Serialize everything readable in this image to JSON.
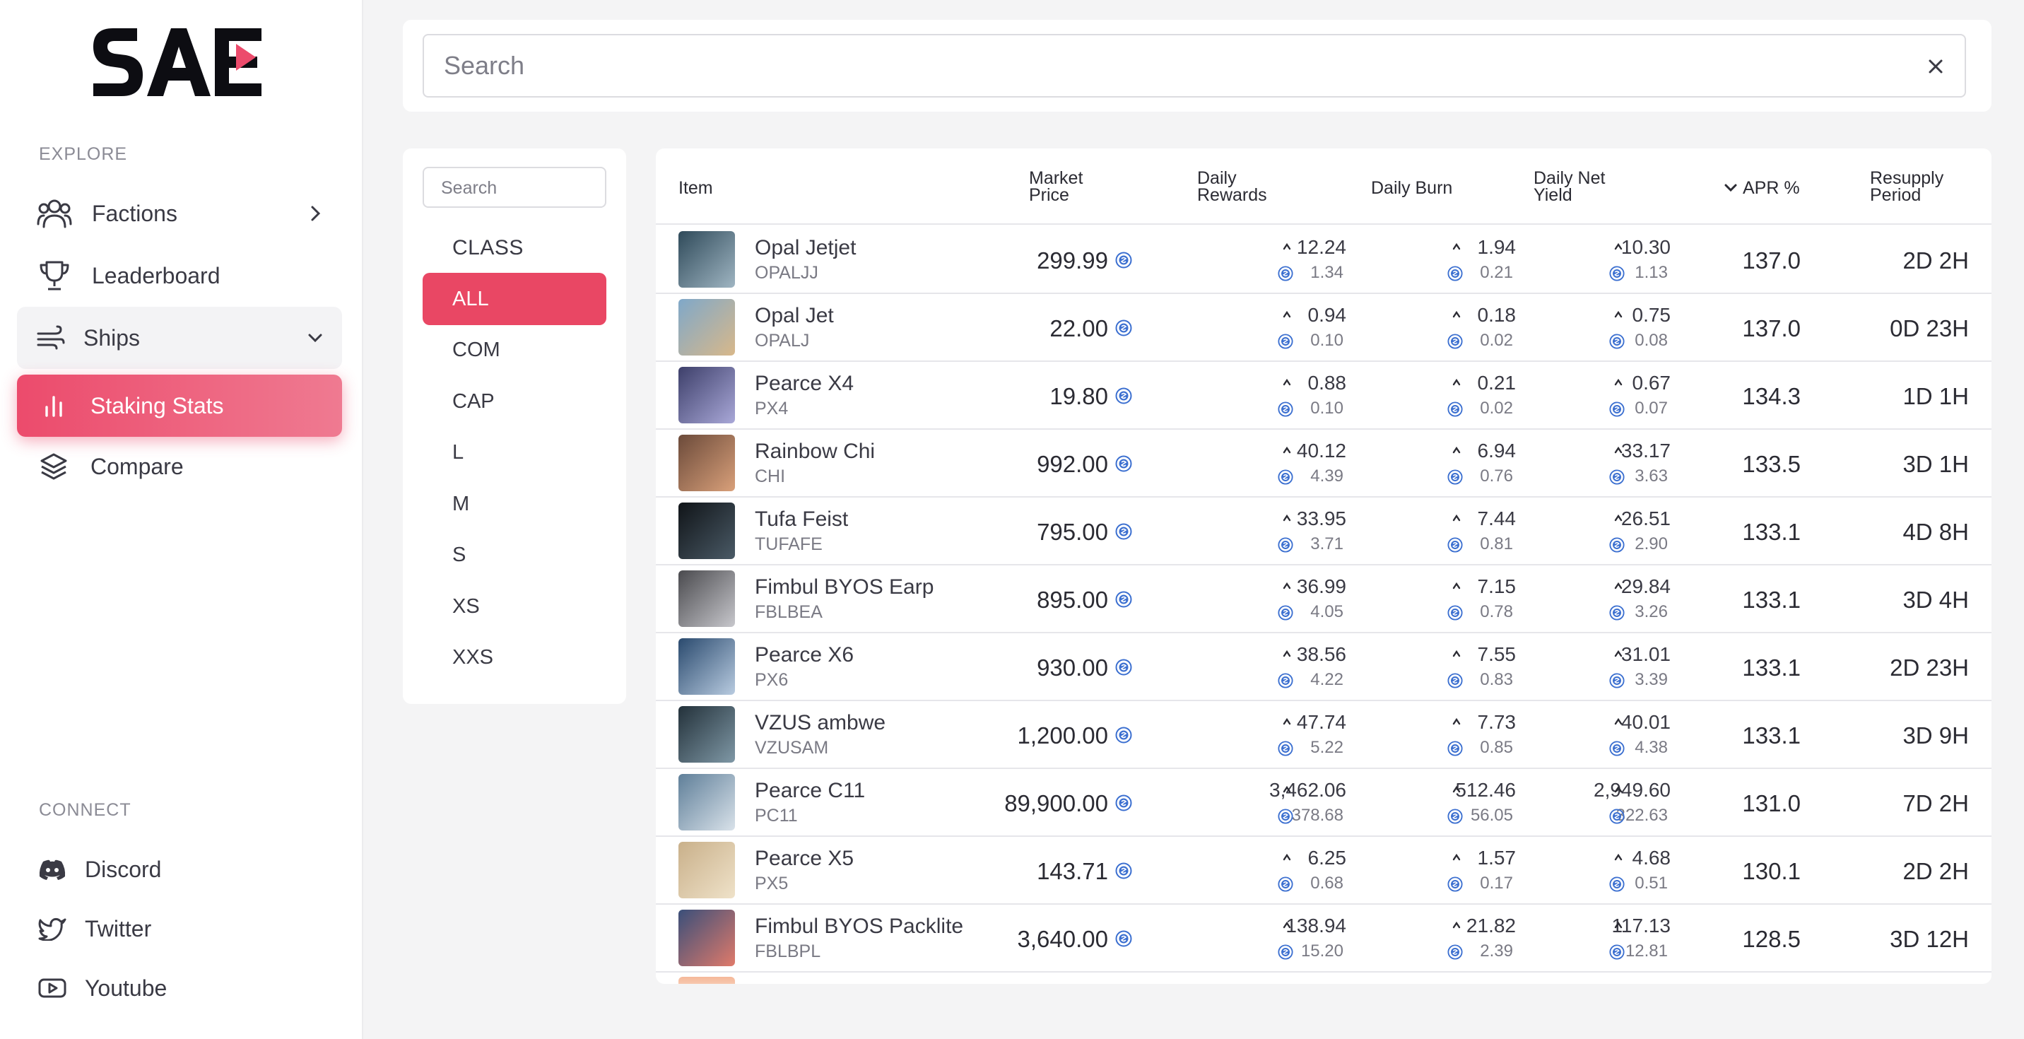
{
  "brand": {
    "logo_text": "SAE",
    "accent": "#e94764"
  },
  "sidebar": {
    "explore_label": "EXPLORE",
    "items": [
      {
        "label": "Factions",
        "icon": "users-icon",
        "chevron": "chevron-right-icon"
      },
      {
        "label": "Leaderboard",
        "icon": "trophy-icon"
      },
      {
        "label": "Ships",
        "icon": "wind-icon",
        "chevron": "chevron-down-icon"
      },
      {
        "label": "Staking Stats",
        "icon": "bar-chart-icon",
        "active": true
      },
      {
        "label": "Compare",
        "icon": "layers-icon"
      }
    ],
    "connect_label": "CONNECT",
    "connect": [
      {
        "label": "Discord",
        "icon": "discord-icon"
      },
      {
        "label": "Twitter",
        "icon": "twitter-icon"
      },
      {
        "label": "Youtube",
        "icon": "youtube-icon"
      }
    ]
  },
  "search": {
    "placeholder": "Search"
  },
  "filter": {
    "search_placeholder": "Search",
    "title": "CLASS",
    "classes": [
      "ALL",
      "COM",
      "CAP",
      "L",
      "M",
      "S",
      "XS",
      "XXS"
    ],
    "selected": "ALL"
  },
  "table": {
    "headers": {
      "item": "Item",
      "market_price": [
        "Market",
        "Price"
      ],
      "daily_rewards": [
        "Daily",
        "Rewards"
      ],
      "daily_burn": "Daily Burn",
      "daily_net_yield": [
        "Daily Net",
        "Yield"
      ],
      "apr": "APR %",
      "resupply": [
        "Resupply",
        "Period"
      ]
    },
    "sort": {
      "column": "apr",
      "direction": "desc"
    },
    "rows": [
      {
        "name": "Opal Jetjet",
        "code": "OPALJJ",
        "price": "299.99",
        "rewards": "12.24",
        "rewards_sub": "1.34",
        "burn": "1.94",
        "burn_sub": "0.21",
        "net": "10.30",
        "net_sub": "1.13",
        "apr": "137.0",
        "resupply": "2D 2H",
        "thumb": [
          "#2f4a5a",
          "#9fb5c2"
        ]
      },
      {
        "name": "Opal Jet",
        "code": "OPALJ",
        "price": "22.00",
        "rewards": "0.94",
        "rewards_sub": "0.10",
        "burn": "0.18",
        "burn_sub": "0.02",
        "net": "0.75",
        "net_sub": "0.08",
        "apr": "137.0",
        "resupply": "0D 23H",
        "thumb": [
          "#7fa8c9",
          "#d8b88a"
        ]
      },
      {
        "name": "Pearce X4",
        "code": "PX4",
        "price": "19.80",
        "rewards": "0.88",
        "rewards_sub": "0.10",
        "burn": "0.21",
        "burn_sub": "0.02",
        "net": "0.67",
        "net_sub": "0.07",
        "apr": "134.3",
        "resupply": "1D 1H",
        "thumb": [
          "#3d3f6a",
          "#a9a8d8"
        ]
      },
      {
        "name": "Rainbow Chi",
        "code": "CHI",
        "price": "992.00",
        "rewards": "40.12",
        "rewards_sub": "4.39",
        "burn": "6.94",
        "burn_sub": "0.76",
        "net": "33.17",
        "net_sub": "3.63",
        "apr": "133.5",
        "resupply": "3D 1H",
        "thumb": [
          "#6b4a3a",
          "#d9a07a"
        ]
      },
      {
        "name": "Tufa Feist",
        "code": "TUFAFE",
        "price": "795.00",
        "rewards": "33.95",
        "rewards_sub": "3.71",
        "burn": "7.44",
        "burn_sub": "0.81",
        "net": "26.51",
        "net_sub": "2.90",
        "apr": "133.1",
        "resupply": "4D 8H",
        "thumb": [
          "#101418",
          "#4a5a66"
        ]
      },
      {
        "name": "Fimbul BYOS Earp",
        "code": "FBLBEA",
        "price": "895.00",
        "rewards": "36.99",
        "rewards_sub": "4.05",
        "burn": "7.15",
        "burn_sub": "0.78",
        "net": "29.84",
        "net_sub": "3.26",
        "apr": "133.1",
        "resupply": "3D 4H",
        "thumb": [
          "#4a4a4e",
          "#c7c7cc"
        ]
      },
      {
        "name": "Pearce X6",
        "code": "PX6",
        "price": "930.00",
        "rewards": "38.56",
        "rewards_sub": "4.22",
        "burn": "7.55",
        "burn_sub": "0.83",
        "net": "31.01",
        "net_sub": "3.39",
        "apr": "133.1",
        "resupply": "2D 23H",
        "thumb": [
          "#2a4a6e",
          "#b8cbe0"
        ]
      },
      {
        "name": "VZUS ambwe",
        "code": "VZUSAM",
        "price": "1,200.00",
        "rewards": "47.74",
        "rewards_sub": "5.22",
        "burn": "7.73",
        "burn_sub": "0.85",
        "net": "40.01",
        "net_sub": "4.38",
        "apr": "133.1",
        "resupply": "3D 9H",
        "thumb": [
          "#23313a",
          "#7f98a6"
        ]
      },
      {
        "name": "Pearce C11",
        "code": "PC11",
        "price": "89,900.00",
        "rewards": "3,462.06",
        "rewards_sub": "378.68",
        "burn": "512.46",
        "burn_sub": "56.05",
        "net": "2,949.60",
        "net_sub": "322.63",
        "apr": "131.0",
        "resupply": "7D 2H",
        "thumb": [
          "#5f7f99",
          "#d9e2ea"
        ]
      },
      {
        "name": "Pearce X5",
        "code": "PX5",
        "price": "143.71",
        "rewards": "6.25",
        "rewards_sub": "0.68",
        "burn": "1.57",
        "burn_sub": "0.17",
        "net": "4.68",
        "net_sub": "0.51",
        "apr": "130.1",
        "resupply": "2D 2H",
        "thumb": [
          "#c9b08a",
          "#efe2c9"
        ]
      },
      {
        "name": "Fimbul BYOS Packlite",
        "code": "FBLBPL",
        "price": "3,640.00",
        "rewards": "138.94",
        "rewards_sub": "15.20",
        "burn": "21.82",
        "burn_sub": "2.39",
        "net": "117.13",
        "net_sub": "12.81",
        "apr": "128.5",
        "resupply": "3D 12H",
        "thumb": [
          "#3a4f7a",
          "#e07a6a"
        ]
      }
    ]
  }
}
